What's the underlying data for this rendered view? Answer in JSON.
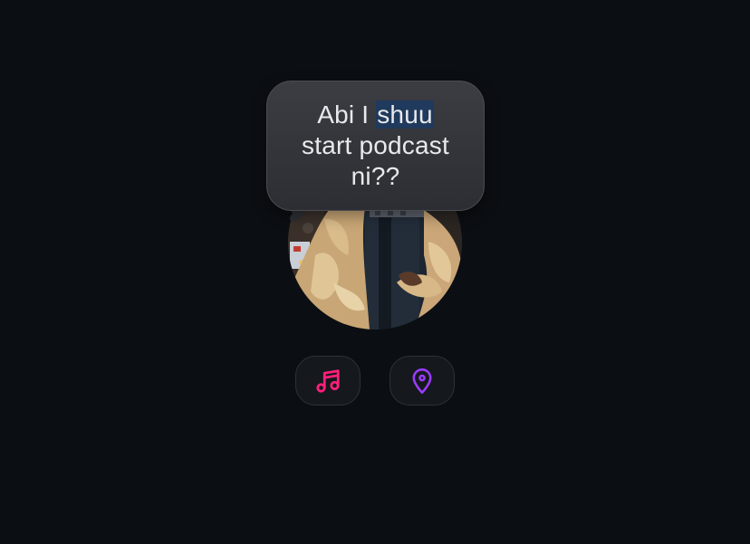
{
  "bubble": {
    "text_before": "Abi I ",
    "highlighted": "shuu",
    "text_after": "start podcast ni??"
  },
  "avatar": {
    "icon": "user-photo"
  },
  "actions": [
    {
      "icon": "music-note-icon",
      "color": "#ff1f7a"
    },
    {
      "icon": "location-pin-icon",
      "color": "#9b3cff"
    }
  ],
  "colors": {
    "background": "#0b0e12",
    "bubble": "#34363b",
    "highlight": "#1f3a5c"
  }
}
